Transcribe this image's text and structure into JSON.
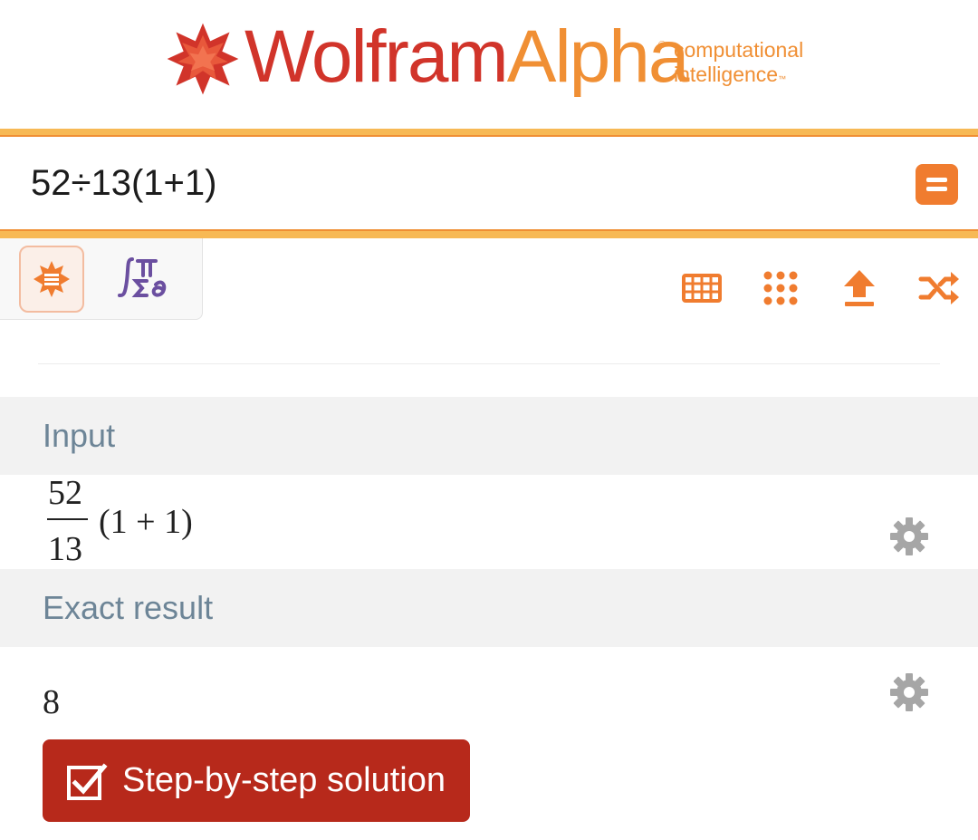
{
  "brand": {
    "wolfram": "Wolfram",
    "alpha": "Alpha",
    "reg_mark": "®",
    "tagline_1": "computational",
    "tagline_2": "intelligence",
    "tm_mark": "™",
    "colors": {
      "red": "#d1342a",
      "orange": "#f08f34",
      "bar_yellow": "#f7b955"
    }
  },
  "search": {
    "value": "52÷13(1+1)",
    "submit_icon": "equals-icon"
  },
  "modes": [
    {
      "name": "natural-language",
      "icon": "wolfram-star-icon",
      "active": true
    },
    {
      "name": "math-input",
      "icon": "math-symbols-icon",
      "active": false
    }
  ],
  "tools": [
    {
      "name": "extended-keyboard",
      "icon": "keyboard-icon"
    },
    {
      "name": "examples",
      "icon": "grid-dots-icon"
    },
    {
      "name": "upload",
      "icon": "upload-icon"
    },
    {
      "name": "random",
      "icon": "shuffle-icon"
    }
  ],
  "pods": {
    "input": {
      "title": "Input",
      "numerator": "52",
      "denominator": "13",
      "rest": "(1 + 1)"
    },
    "result": {
      "title": "Exact result",
      "value": "8",
      "steps_label": "Step-by-step solution"
    }
  }
}
